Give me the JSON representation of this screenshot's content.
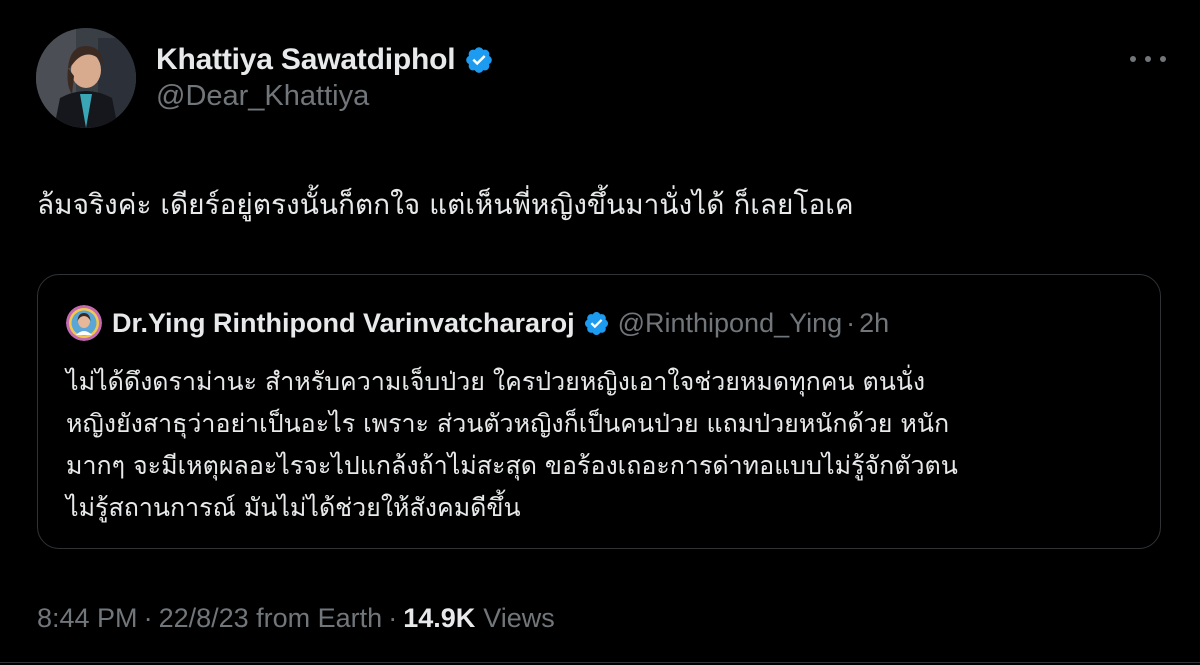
{
  "colors": {
    "background": "#000000",
    "primary_text": "#e7e9ea",
    "secondary_text": "#71767b",
    "border": "#2f3336",
    "verified_badge": "#1d9bf0"
  },
  "author": {
    "name": "Khattiya Sawatdiphol",
    "handle": "@Dear_Khattiya",
    "avatar_icon": "profile-photo",
    "verified_icon": "verified-badge-icon"
  },
  "more_icon": "more-horizontal-icon",
  "tweet": {
    "text": "ล้มจริงค่ะ เดียร์อยู่ตรงนั้นก็ตกใจ แต่เห็นพี่หญิงขึ้นมานั่งได้ ก็เลยโอเค"
  },
  "quote": {
    "name": "Dr.Ying Rinthipond Varinvatchararoj",
    "handle": "@Rinthipond_Ying",
    "separator": "·",
    "time": "2h",
    "lines": [
      "ไม่ได้ดึงดราม่านะ  สำหรับความเจ็บป่วย ใครป่วยหญิงเอาใจช่วยหมดทุกคน  ตนนั่ง",
      "หญิงยังสาธุว่าอย่าเป็นอะไร  เพราะ ส่วนตัวหญิงก็เป็นคนป่วย แถมป่วยหนักด้วย หนัก",
      "มากๆ จะมีเหตุผลอะไรจะไปแกล้งถ้าไม่สะสุด ขอร้องเถอะการด่าทอแบบไม่รู้จักตัวตน",
      "ไม่รู้สถานการณ์  มันไม่ได้ช่วยให้สังคมดีขึ้น"
    ]
  },
  "meta": {
    "time": "8:44 PM",
    "separator": "·",
    "date": "22/8/23 from Earth",
    "views_count": "14.9K",
    "views_label": "Views"
  }
}
